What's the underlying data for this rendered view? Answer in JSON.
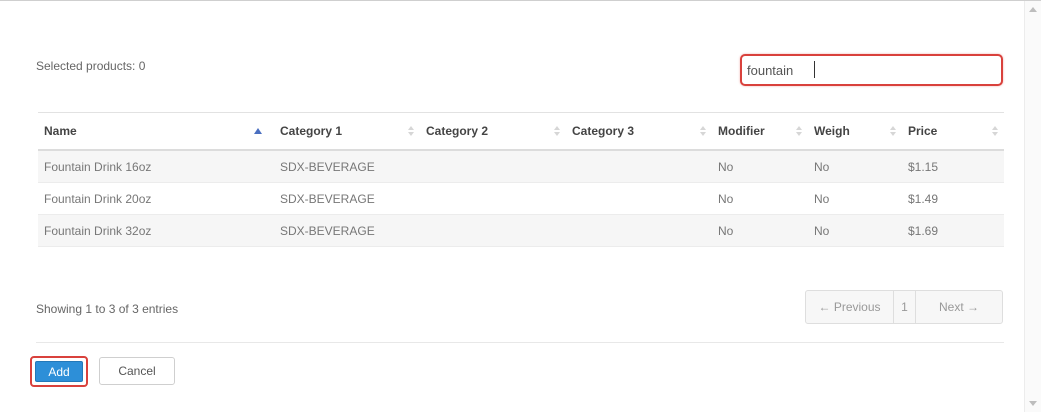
{
  "header": {
    "selected_label": "Selected products: 0"
  },
  "search": {
    "value": "fountain",
    "placeholder": ""
  },
  "table": {
    "columns": [
      "Name",
      "Category 1",
      "Category 2",
      "Category 3",
      "Modifier",
      "Weigh",
      "Price"
    ],
    "sort_column": "Name",
    "sort_direction": "ascending",
    "rows": [
      [
        "Fountain Drink 16oz",
        "SDX-BEVERAGE",
        "",
        "",
        "No",
        "No",
        "$1.15"
      ],
      [
        "Fountain Drink 20oz",
        "SDX-BEVERAGE",
        "",
        "",
        "No",
        "No",
        "$1.49"
      ],
      [
        "Fountain Drink 32oz",
        "SDX-BEVERAGE",
        "",
        "",
        "No",
        "No",
        "$1.69"
      ]
    ]
  },
  "footer": {
    "entries_info": "Showing 1 to 3 of 3 entries"
  },
  "pagination": {
    "previous_label": "← Previous",
    "current_page": "1",
    "next_label": "Next →"
  },
  "actions": {
    "add_label": "Add",
    "cancel_label": "Cancel"
  },
  "colors": {
    "highlight_outline": "#d9413c",
    "primary_button": "#2d8fd8",
    "sort_indicator": "#4a6fc0"
  }
}
